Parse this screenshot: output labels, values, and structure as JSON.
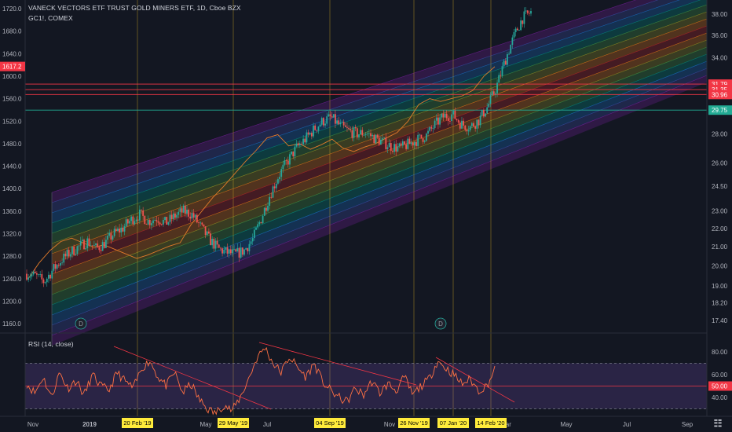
{
  "header": {
    "title": "VANECK VECTORS ETF TRUST GOLD MINERS ETF, 1D, Cboe BZX",
    "compare_symbol": "GC1!, COMEX"
  },
  "chart_data": [
    {
      "type": "candlestick",
      "title": "VANECK VECTORS ETF TRUST GOLD MINERS ETF, 1D, Cboe BZX",
      "left_axis": {
        "ticks": [
          "1720.0",
          "1680.0",
          "1640.0",
          "1600.0",
          "1560.0",
          "1520.0",
          "1480.0",
          "1440.0",
          "1400.0",
          "1360.0",
          "1320.0",
          "1280.0",
          "1240.0",
          "1200.0",
          "1160.0"
        ],
        "last_value": "1617.2"
      },
      "right_axis": {
        "ticks": [
          "38.00",
          "36.00",
          "34.00",
          "28.00",
          "26.00",
          "24.50",
          "23.00",
          "22.00",
          "21.00",
          "20.00",
          "19.00",
          "18.20",
          "17.40"
        ],
        "scale": "log",
        "price_labels": [
          {
            "value": "31.79",
            "color": "#f23645"
          },
          {
            "value": "31.35",
            "color": "#f23645"
          },
          {
            "value": "30.96",
            "color": "#f23645"
          },
          {
            "value": "29.75",
            "color": "#22ab94"
          }
        ]
      },
      "x_ticks": [
        "Nov",
        "2019",
        "Mar",
        "May",
        "Jul",
        "Sep",
        "Nov",
        "2020",
        "Mar",
        "May",
        "Jul",
        "Sep"
      ],
      "date_labels": [
        "20 Feb '19",
        "29 May '19",
        "04 Sep '19",
        "26 Nov '19",
        "07 Jan '20",
        "14 Feb '20"
      ],
      "dividend_markers": [
        "D",
        "D"
      ],
      "close_path": [
        19.6,
        19.5,
        19.2,
        19.8,
        20.3,
        20.7,
        21.0,
        21.3,
        20.9,
        21.2,
        21.7,
        22.0,
        22.5,
        22.8,
        22.4,
        22.6,
        22.3,
        22.7,
        23.0,
        22.8,
        22.1,
        21.4,
        20.9,
        20.7,
        20.6,
        20.8,
        21.4,
        22.6,
        24.0,
        25.2,
        26.1,
        27.0,
        27.6,
        28.3,
        28.9,
        29.2,
        28.6,
        28.2,
        28.0,
        28.1,
        27.7,
        27.4,
        27.1,
        27.0,
        27.3,
        27.6,
        27.9,
        28.7,
        29.3,
        29.4,
        28.7,
        28.5,
        29.0,
        30.0,
        31.5,
        33.7,
        35.8,
        37.6,
        38.2
      ],
      "gold_path": [
        1240,
        1268,
        1290,
        1306,
        1312,
        1304,
        1296,
        1300,
        1292,
        1284,
        1276,
        1282,
        1290,
        1298,
        1304,
        1336,
        1360,
        1384,
        1404,
        1426,
        1448,
        1468,
        1490,
        1496,
        1476,
        1480,
        1470,
        1478,
        1488,
        1472,
        1466,
        1474,
        1480,
        1490,
        1500,
        1520,
        1550,
        1560,
        1555,
        1560,
        1565,
        1575,
        1600,
        1617
      ],
      "channel": {
        "bands": 15,
        "colors": [
          "#7b1fa2",
          "#3f51b5",
          "#1976d2",
          "#009688",
          "#43a047",
          "#9e9d24",
          "#f57f17",
          "#c62828"
        ]
      },
      "horizontal_lines": [
        {
          "value": 31.79,
          "color": "#f23645"
        },
        {
          "value": 31.35,
          "color": "#f23645"
        },
        {
          "value": 30.96,
          "color": "#f23645"
        },
        {
          "value": 29.75,
          "color": "#22ab94"
        }
      ]
    },
    {
      "type": "line",
      "title": "RSI (14, close)",
      "y_ticks": [
        "80.00",
        "60.00",
        "40.00"
      ],
      "ylim": [
        20,
        90
      ],
      "bands": [
        70,
        30
      ],
      "last_value": "50.00",
      "rsi_path": [
        52,
        44,
        58,
        40,
        62,
        48,
        55,
        42,
        60,
        50,
        46,
        62,
        54,
        48,
        66,
        72,
        58,
        50,
        62,
        44,
        52,
        38,
        30,
        26,
        34,
        28,
        40,
        56,
        74,
        84,
        70,
        62,
        76,
        66,
        58,
        70,
        54,
        46,
        40,
        36,
        48,
        42,
        54,
        44,
        52,
        46,
        58,
        42,
        50,
        56,
        72,
        66,
        60,
        52,
        56,
        46,
        50,
        64
      ]
    }
  ]
}
